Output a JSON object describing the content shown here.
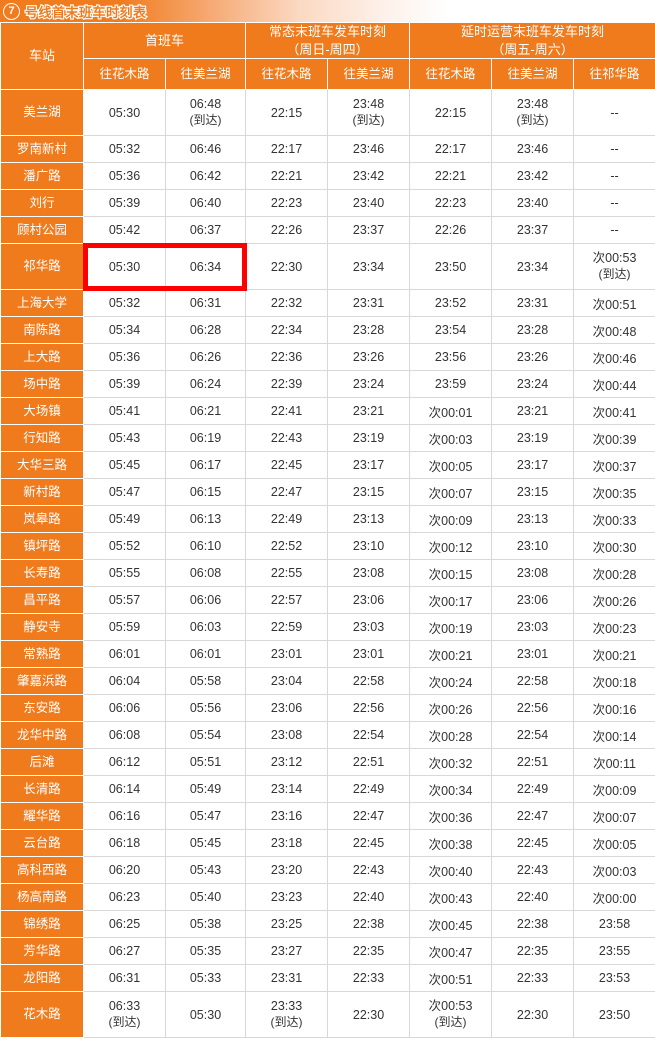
{
  "title": {
    "line_badge": "7",
    "text": "号线首末班车时刻表",
    "accent_color": "#ef7b1d"
  },
  "table": {
    "station_header": "车站",
    "groups": [
      {
        "label": "首班车",
        "sublabels": [
          "往花木路",
          "往美兰湖"
        ]
      },
      {
        "label": "常态末班车发车时刻",
        "sublabel_note": "（周日-周四）",
        "sublabels": [
          "往花木路",
          "往美兰湖"
        ]
      },
      {
        "label": "延时运营末班车发车时刻",
        "sublabel_note": "（周五-周六）",
        "sublabels": [
          "往花木路",
          "往美兰湖",
          "往祁华路"
        ]
      }
    ],
    "arrival_note": "(到达)",
    "highlight": {
      "color": "#ff0000",
      "station": "祁华路",
      "columns": [
        "往花木路",
        "往美兰湖"
      ],
      "group": "首班车"
    },
    "rows": [
      {
        "station": "美兰湖",
        "tall": true,
        "cells": [
          "05:30",
          "06:48|(到达)",
          "22:15",
          "23:48|(到达)",
          "22:15",
          "23:48|(到达)",
          "--"
        ]
      },
      {
        "station": "罗南新村",
        "tall": false,
        "cells": [
          "05:32",
          "06:46",
          "22:17",
          "23:46",
          "22:17",
          "23:46",
          "--"
        ]
      },
      {
        "station": "潘广路",
        "tall": false,
        "cells": [
          "05:36",
          "06:42",
          "22:21",
          "23:42",
          "22:21",
          "23:42",
          "--"
        ]
      },
      {
        "station": "刘行",
        "tall": false,
        "cells": [
          "05:39",
          "06:40",
          "22:23",
          "23:40",
          "22:23",
          "23:40",
          "--"
        ]
      },
      {
        "station": "顾村公园",
        "tall": false,
        "cells": [
          "05:42",
          "06:37",
          "22:26",
          "23:37",
          "22:26",
          "23:37",
          "--"
        ]
      },
      {
        "station": "祁华路",
        "tall": true,
        "cells": [
          "05:30",
          "06:34",
          "22:30",
          "23:34",
          "23:50",
          "23:34",
          "次00:53|(到达)"
        ]
      },
      {
        "station": "上海大学",
        "tall": false,
        "cells": [
          "05:32",
          "06:31",
          "22:32",
          "23:31",
          "23:52",
          "23:31",
          "次00:51"
        ]
      },
      {
        "station": "南陈路",
        "tall": false,
        "cells": [
          "05:34",
          "06:28",
          "22:34",
          "23:28",
          "23:54",
          "23:28",
          "次00:48"
        ]
      },
      {
        "station": "上大路",
        "tall": false,
        "cells": [
          "05:36",
          "06:26",
          "22:36",
          "23:26",
          "23:56",
          "23:26",
          "次00:46"
        ]
      },
      {
        "station": "场中路",
        "tall": false,
        "cells": [
          "05:39",
          "06:24",
          "22:39",
          "23:24",
          "23:59",
          "23:24",
          "次00:44"
        ]
      },
      {
        "station": "大场镇",
        "tall": false,
        "cells": [
          "05:41",
          "06:21",
          "22:41",
          "23:21",
          "次00:01",
          "23:21",
          "次00:41"
        ]
      },
      {
        "station": "行知路",
        "tall": false,
        "cells": [
          "05:43",
          "06:19",
          "22:43",
          "23:19",
          "次00:03",
          "23:19",
          "次00:39"
        ]
      },
      {
        "station": "大华三路",
        "tall": false,
        "cells": [
          "05:45",
          "06:17",
          "22:45",
          "23:17",
          "次00:05",
          "23:17",
          "次00:37"
        ]
      },
      {
        "station": "新村路",
        "tall": false,
        "cells": [
          "05:47",
          "06:15",
          "22:47",
          "23:15",
          "次00:07",
          "23:15",
          "次00:35"
        ]
      },
      {
        "station": "岚皋路",
        "tall": false,
        "cells": [
          "05:49",
          "06:13",
          "22:49",
          "23:13",
          "次00:09",
          "23:13",
          "次00:33"
        ]
      },
      {
        "station": "镇坪路",
        "tall": false,
        "cells": [
          "05:52",
          "06:10",
          "22:52",
          "23:10",
          "次00:12",
          "23:10",
          "次00:30"
        ]
      },
      {
        "station": "长寿路",
        "tall": false,
        "cells": [
          "05:55",
          "06:08",
          "22:55",
          "23:08",
          "次00:15",
          "23:08",
          "次00:28"
        ]
      },
      {
        "station": "昌平路",
        "tall": false,
        "cells": [
          "05:57",
          "06:06",
          "22:57",
          "23:06",
          "次00:17",
          "23:06",
          "次00:26"
        ]
      },
      {
        "station": "静安寺",
        "tall": false,
        "cells": [
          "05:59",
          "06:03",
          "22:59",
          "23:03",
          "次00:19",
          "23:03",
          "次00:23"
        ]
      },
      {
        "station": "常熟路",
        "tall": false,
        "cells": [
          "06:01",
          "06:01",
          "23:01",
          "23:01",
          "次00:21",
          "23:01",
          "次00:21"
        ]
      },
      {
        "station": "肇嘉浜路",
        "tall": false,
        "cells": [
          "06:04",
          "05:58",
          "23:04",
          "22:58",
          "次00:24",
          "22:58",
          "次00:18"
        ]
      },
      {
        "station": "东安路",
        "tall": false,
        "cells": [
          "06:06",
          "05:56",
          "23:06",
          "22:56",
          "次00:26",
          "22:56",
          "次00:16"
        ]
      },
      {
        "station": "龙华中路",
        "tall": false,
        "cells": [
          "06:08",
          "05:54",
          "23:08",
          "22:54",
          "次00:28",
          "22:54",
          "次00:14"
        ]
      },
      {
        "station": "后滩",
        "tall": false,
        "cells": [
          "06:12",
          "05:51",
          "23:12",
          "22:51",
          "次00:32",
          "22:51",
          "次00:11"
        ]
      },
      {
        "station": "长清路",
        "tall": false,
        "cells": [
          "06:14",
          "05:49",
          "23:14",
          "22:49",
          "次00:34",
          "22:49",
          "次00:09"
        ]
      },
      {
        "station": "耀华路",
        "tall": false,
        "cells": [
          "06:16",
          "05:47",
          "23:16",
          "22:47",
          "次00:36",
          "22:47",
          "次00:07"
        ]
      },
      {
        "station": "云台路",
        "tall": false,
        "cells": [
          "06:18",
          "05:45",
          "23:18",
          "22:45",
          "次00:38",
          "22:45",
          "次00:05"
        ]
      },
      {
        "station": "高科西路",
        "tall": false,
        "cells": [
          "06:20",
          "05:43",
          "23:20",
          "22:43",
          "次00:40",
          "22:43",
          "次00:03"
        ]
      },
      {
        "station": "杨高南路",
        "tall": false,
        "cells": [
          "06:23",
          "05:40",
          "23:23",
          "22:40",
          "次00:43",
          "22:40",
          "次00:00"
        ]
      },
      {
        "station": "锦绣路",
        "tall": false,
        "cells": [
          "06:25",
          "05:38",
          "23:25",
          "22:38",
          "次00:45",
          "22:38",
          "23:58"
        ]
      },
      {
        "station": "芳华路",
        "tall": false,
        "cells": [
          "06:27",
          "05:35",
          "23:27",
          "22:35",
          "次00:47",
          "22:35",
          "23:55"
        ]
      },
      {
        "station": "龙阳路",
        "tall": false,
        "cells": [
          "06:31",
          "05:33",
          "23:31",
          "22:33",
          "次00:51",
          "22:33",
          "23:53"
        ]
      },
      {
        "station": "花木路",
        "tall": true,
        "cells": [
          "06:33|(到达)",
          "05:30",
          "23:33|(到达)",
          "22:30",
          "次00:53|(到达)",
          "22:30",
          "23:50"
        ]
      }
    ]
  }
}
